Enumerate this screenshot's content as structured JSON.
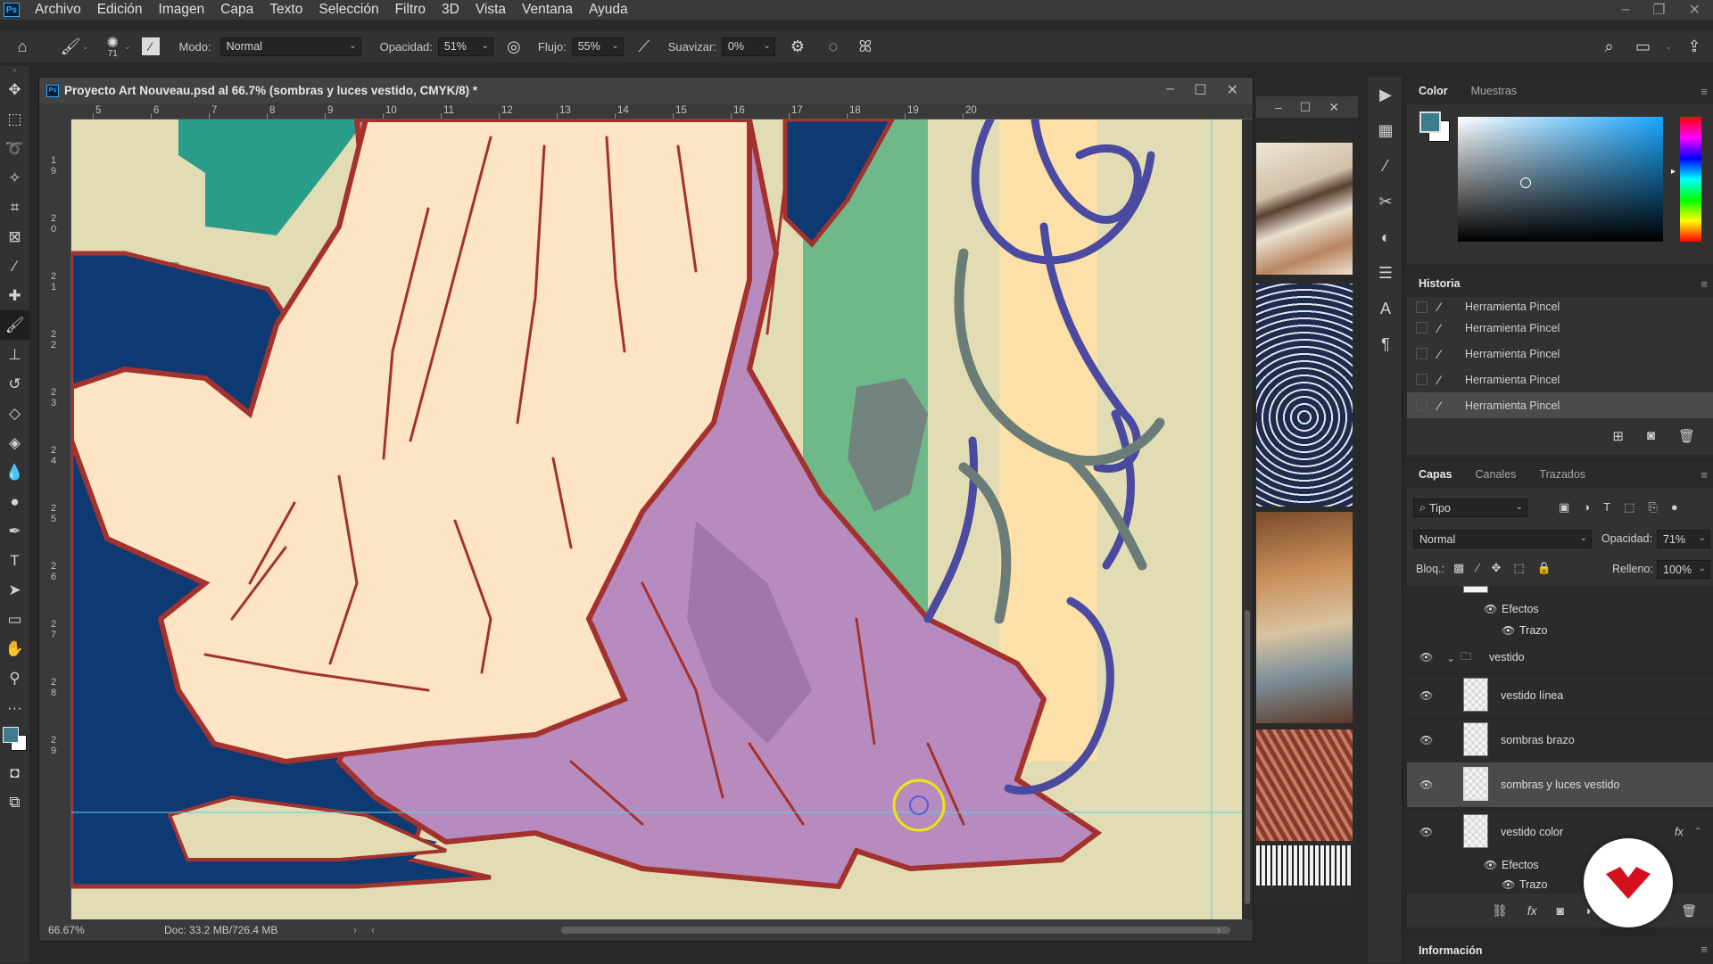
{
  "menu": {
    "items": [
      "Archivo",
      "Edición",
      "Imagen",
      "Capa",
      "Texto",
      "Selección",
      "Filtro",
      "3D",
      "Vista",
      "Ventana",
      "Ayuda"
    ],
    "logo": "Ps"
  },
  "options_bar": {
    "brush_size": "71",
    "mode_label": "Modo:",
    "mode_value": "Normal",
    "opacity_label": "Opacidad:",
    "opacity_value": "51%",
    "flow_label": "Flujo:",
    "flow_value": "55%",
    "smoothing_label": "Suavizar:",
    "smoothing_value": "0%"
  },
  "document": {
    "title": "Proyecto Art Nouveau.psd al 66.7% (sombras y luces vestido, CMYK/8) *",
    "zoom": "66.67%",
    "doc_info": "Doc: 33.2 MB/726.4 MB",
    "ruler_h": [
      "5",
      "6",
      "7",
      "8",
      "9",
      "10",
      "11",
      "12",
      "13",
      "14",
      "15",
      "16",
      "17",
      "18",
      "19",
      "20"
    ],
    "ruler_v": [
      "1\n9",
      "2\n0",
      "2\n1",
      "2\n2",
      "2\n3",
      "2\n4",
      "2\n5",
      "2\n6",
      "2\n7",
      "2\n8",
      "2\n9"
    ]
  },
  "color_panel": {
    "tabs": [
      "Color",
      "Muestras"
    ],
    "foreground": "#3d7c8e",
    "background": "#ffffff"
  },
  "history_panel": {
    "title": "Historia",
    "items": [
      "Herramienta Pincel",
      "Herramienta Pincel",
      "Herramienta Pincel",
      "Herramienta Pincel",
      "Herramienta Pincel"
    ]
  },
  "layers_panel": {
    "tabs": [
      "Capas",
      "Canales",
      "Trazados"
    ],
    "filter_label": "Tipo",
    "blend_mode": "Normal",
    "opacity_label": "Opacidad:",
    "opacity_value": "71%",
    "lock_label": "Bloq.:",
    "fill_label": "Relleno:",
    "fill_value": "100%",
    "top_effects": [
      "Efectos",
      "Trazo"
    ],
    "group_name": "vestido",
    "layers": [
      {
        "name": "vestido línea"
      },
      {
        "name": "sombras brazo"
      },
      {
        "name": "sombras y luces vestido"
      },
      {
        "name": "vestido color",
        "fx": "fx"
      }
    ],
    "bottom_effects": [
      "Efectos",
      "Trazo"
    ]
  },
  "info_panel": {
    "title": "Información"
  },
  "accent_colors": {
    "navy": "#0d3a73",
    "lilac": "#b88bbf",
    "cream": "#fde4c4",
    "outline": "#a3322e",
    "teal": "#2a9d8a",
    "green": "#6fb88a"
  }
}
